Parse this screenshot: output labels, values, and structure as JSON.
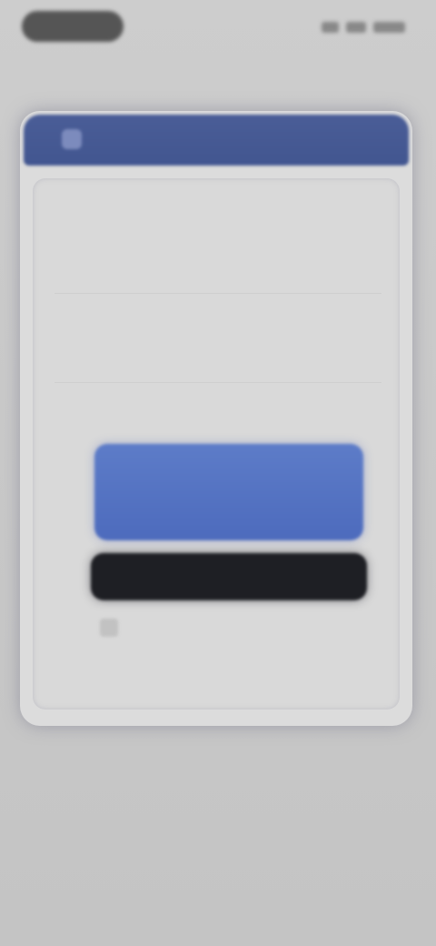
{
  "status_bar": {
    "time": "",
    "subtext": ""
  },
  "dialog": {
    "title": "",
    "fields": {
      "label_1": "",
      "value_1": "",
      "label_2": "",
      "value_2": ""
    },
    "primary_button": "",
    "secondary_button": "",
    "checkbox_label": "",
    "footer_text": ""
  },
  "bottom_link": "",
  "colors": {
    "header": "#4a5d97",
    "primary": "#5d7cc8",
    "secondary": "#1e1f24",
    "background": "#c9c9c9"
  }
}
